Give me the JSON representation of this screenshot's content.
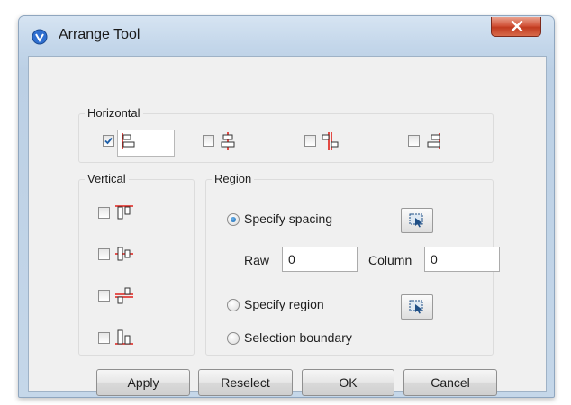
{
  "window": {
    "title": "Arrange Tool",
    "close_label": "x"
  },
  "horizontal": {
    "title": "Horizontal",
    "options": [
      {
        "icon": "align-left-icon",
        "checked": true
      },
      {
        "icon": "align-center-horizontal-icon",
        "checked": false
      },
      {
        "icon": "distribute-horizontal-icon",
        "checked": false
      },
      {
        "icon": "align-right-icon",
        "checked": false
      }
    ]
  },
  "vertical": {
    "title": "Vertical",
    "options": [
      {
        "icon": "align-top-icon",
        "checked": false
      },
      {
        "icon": "align-middle-vertical-icon",
        "checked": false
      },
      {
        "icon": "distribute-vertical-icon",
        "checked": false
      },
      {
        "icon": "align-bottom-icon",
        "checked": false
      }
    ]
  },
  "region": {
    "title": "Region",
    "specify_spacing_label": "Specify spacing",
    "specify_spacing_selected": true,
    "raw_label": "Raw",
    "raw_value": "0",
    "column_label": "Column",
    "column_value": "0",
    "specify_region_label": "Specify region",
    "selection_boundary_label": "Selection boundary"
  },
  "buttons": {
    "apply": "Apply",
    "reselect": "Reselect",
    "ok": "OK",
    "cancel": "Cancel"
  },
  "colors": {
    "icon_red": "#e0201a",
    "icon_dark": "#333333",
    "radio_blue": "#1d6fb8",
    "close_red": "#c13b20"
  }
}
